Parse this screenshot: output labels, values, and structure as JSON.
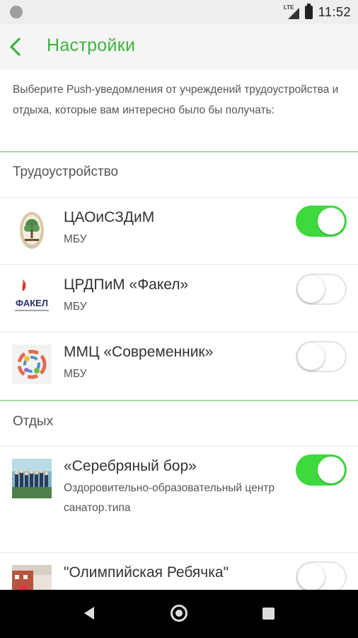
{
  "status_bar": {
    "network": "LTE",
    "time": "11:52"
  },
  "app_bar": {
    "title": "Настройки"
  },
  "intro_text": "Выберите Push-уведомления от учреждений трудоустройства и отдыха, которые вам интересно было бы получать:",
  "sections": [
    {
      "title": "Трудоустройство",
      "items": [
        {
          "name": "ЦАОиСЗДиМ",
          "subtitle": "МБУ",
          "enabled": true,
          "logo": "tree-logo"
        },
        {
          "name": "ЦРДПиМ «Факел»",
          "subtitle": "МБУ",
          "enabled": false,
          "logo": "fakel-logo"
        },
        {
          "name": "ММЦ «Современник»",
          "subtitle": "МБУ",
          "enabled": false,
          "logo": "sovremennik-logo"
        }
      ]
    },
    {
      "title": "Отдых",
      "items": [
        {
          "name": "«Серебряный бор»",
          "subtitle": "Оздоровительно-образовательный центр санатор.типа",
          "enabled": true,
          "logo": "group-photo"
        },
        {
          "name": "\"Олимпийская Ребячка\"",
          "subtitle": "",
          "enabled": false,
          "logo": "building-photo"
        }
      ]
    }
  ],
  "fakel_logo_text": "ФАКЕЛ",
  "colors": {
    "accent": "#3cb43c",
    "toggle_on": "#3dd93d",
    "separator": "#a5dca5"
  }
}
